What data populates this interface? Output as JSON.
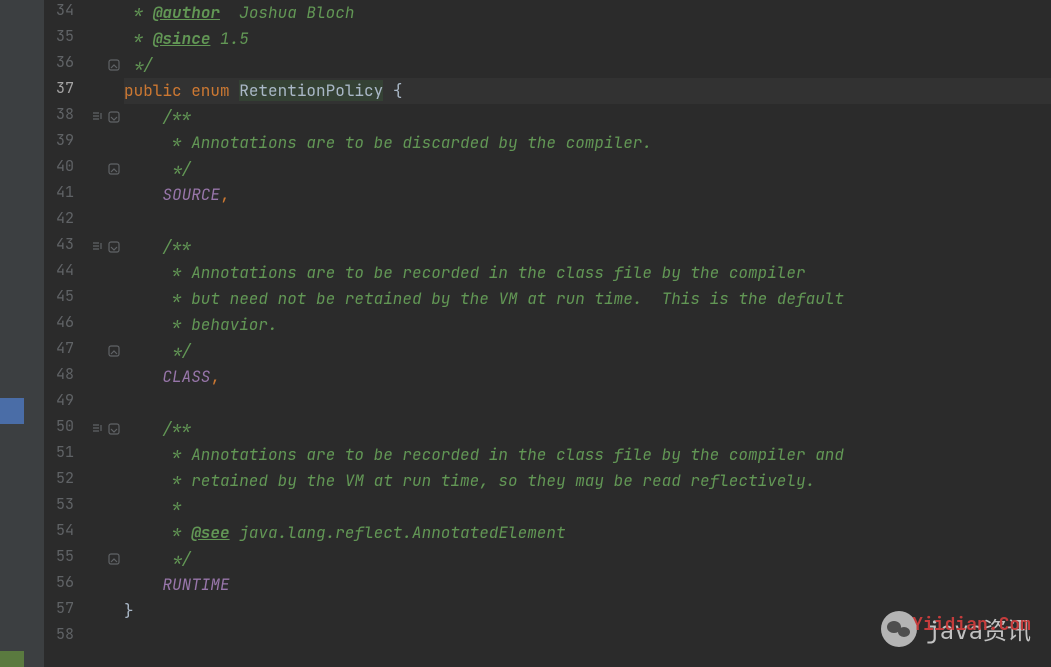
{
  "lines": [
    {
      "num": "34",
      "fold": "",
      "indent": false,
      "segments": [
        {
          "t": " * ",
          "c": "doc-comment"
        },
        {
          "t": "@author",
          "c": "doc-tag"
        },
        {
          "t": "  Joshua Bloch",
          "c": "doc-comment"
        }
      ]
    },
    {
      "num": "35",
      "fold": "",
      "indent": false,
      "segments": [
        {
          "t": " * ",
          "c": "doc-comment"
        },
        {
          "t": "@since",
          "c": "doc-tag"
        },
        {
          "t": " 1.5",
          "c": "doc-comment"
        }
      ]
    },
    {
      "num": "36",
      "fold": "close",
      "indent": false,
      "segments": [
        {
          "t": " */",
          "c": "doc-comment"
        }
      ]
    },
    {
      "num": "37",
      "fold": "",
      "indent": false,
      "active": true,
      "highlighted": true,
      "segments": [
        {
          "t": "public ",
          "c": "keyword"
        },
        {
          "t": "enum ",
          "c": "keyword"
        },
        {
          "t": "RetentionPolicy",
          "c": "class-name"
        },
        {
          "t": " {",
          "c": "brace"
        }
      ]
    },
    {
      "num": "38",
      "fold": "open",
      "indent": true,
      "segments": [
        {
          "t": "    /**",
          "c": "doc-comment"
        }
      ]
    },
    {
      "num": "39",
      "fold": "",
      "indent": false,
      "segments": [
        {
          "t": "     * Annotations are to be discarded by the compiler.",
          "c": "doc-comment"
        }
      ]
    },
    {
      "num": "40",
      "fold": "close",
      "indent": false,
      "segments": [
        {
          "t": "     */",
          "c": "doc-comment"
        }
      ]
    },
    {
      "num": "41",
      "fold": "",
      "indent": false,
      "segments": [
        {
          "t": "    ",
          "c": ""
        },
        {
          "t": "SOURCE",
          "c": "constant"
        },
        {
          "t": ",",
          "c": "comma"
        }
      ]
    },
    {
      "num": "42",
      "fold": "",
      "indent": false,
      "segments": []
    },
    {
      "num": "43",
      "fold": "open",
      "indent": true,
      "segments": [
        {
          "t": "    /**",
          "c": "doc-comment"
        }
      ]
    },
    {
      "num": "44",
      "fold": "",
      "indent": false,
      "segments": [
        {
          "t": "     * Annotations are to be recorded in the class file by the compiler",
          "c": "doc-comment"
        }
      ]
    },
    {
      "num": "45",
      "fold": "",
      "indent": false,
      "segments": [
        {
          "t": "     * but need not be retained by the VM at run time.  This is the default",
          "c": "doc-comment"
        }
      ]
    },
    {
      "num": "46",
      "fold": "",
      "indent": false,
      "segments": [
        {
          "t": "     * behavior.",
          "c": "doc-comment"
        }
      ]
    },
    {
      "num": "47",
      "fold": "close",
      "indent": false,
      "segments": [
        {
          "t": "     */",
          "c": "doc-comment"
        }
      ]
    },
    {
      "num": "48",
      "fold": "",
      "indent": false,
      "segments": [
        {
          "t": "    ",
          "c": ""
        },
        {
          "t": "CLASS",
          "c": "constant"
        },
        {
          "t": ",",
          "c": "comma"
        }
      ]
    },
    {
      "num": "49",
      "fold": "",
      "indent": false,
      "segments": []
    },
    {
      "num": "50",
      "fold": "open",
      "indent": true,
      "segments": [
        {
          "t": "    /**",
          "c": "doc-comment"
        }
      ]
    },
    {
      "num": "51",
      "fold": "",
      "indent": false,
      "segments": [
        {
          "t": "     * Annotations are to be recorded in the class file by the compiler and",
          "c": "doc-comment"
        }
      ]
    },
    {
      "num": "52",
      "fold": "",
      "indent": false,
      "segments": [
        {
          "t": "     * retained by the VM at run time, so they may be read reflectively.",
          "c": "doc-comment"
        }
      ]
    },
    {
      "num": "53",
      "fold": "",
      "indent": false,
      "segments": [
        {
          "t": "     *",
          "c": "doc-comment"
        }
      ]
    },
    {
      "num": "54",
      "fold": "",
      "indent": false,
      "segments": [
        {
          "t": "     * ",
          "c": "doc-comment"
        },
        {
          "t": "@see",
          "c": "doc-tag"
        },
        {
          "t": " java.lang.reflect.AnnotatedElement",
          "c": "doc-comment"
        }
      ]
    },
    {
      "num": "55",
      "fold": "close",
      "indent": false,
      "segments": [
        {
          "t": "     */",
          "c": "doc-comment"
        }
      ]
    },
    {
      "num": "56",
      "fold": "",
      "indent": false,
      "segments": [
        {
          "t": "    ",
          "c": ""
        },
        {
          "t": "RUNTIME",
          "c": "constant"
        }
      ]
    },
    {
      "num": "57",
      "fold": "",
      "indent": false,
      "segments": [
        {
          "t": "}",
          "c": "brace"
        }
      ]
    },
    {
      "num": "58",
      "fold": "",
      "indent": false,
      "segments": []
    }
  ],
  "watermark": {
    "text": "java资讯",
    "red_text": "Yiidian.Com"
  }
}
